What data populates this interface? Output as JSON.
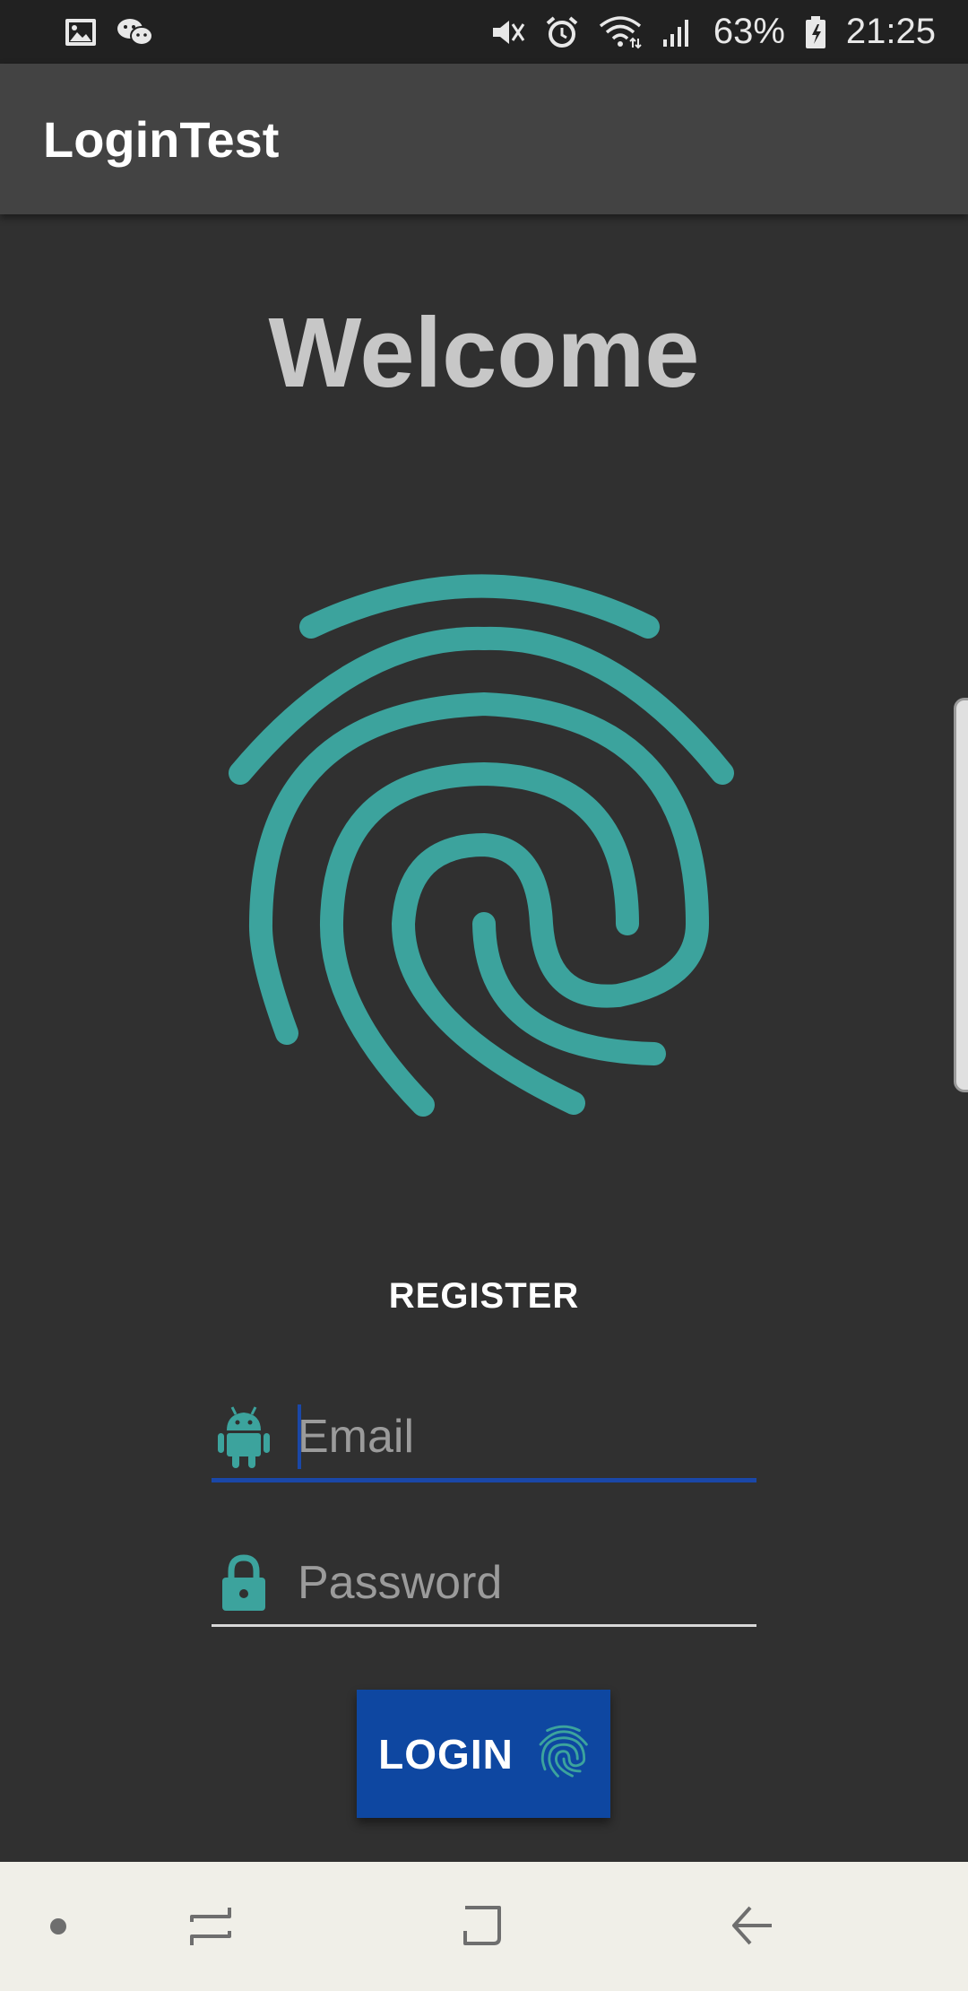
{
  "status_bar": {
    "battery": "63%",
    "time": "21:25",
    "left_icons": [
      "image-icon",
      "wechat-icon"
    ],
    "right_icons": [
      "vibrate-mute-icon",
      "alarm-icon",
      "wifi-icon",
      "signal-icon",
      "battery-charging-icon"
    ]
  },
  "app_bar": {
    "title": "LoginTest"
  },
  "main": {
    "welcome": "Welcome",
    "register_label": "REGISTER",
    "email": {
      "placeholder": "Email",
      "value": "",
      "icon": "android-icon"
    },
    "password": {
      "placeholder": "Password",
      "value": "",
      "icon": "lock-icon"
    },
    "login_label": "LOGIN",
    "login_icon": "fingerprint-icon"
  },
  "colors": {
    "background": "#303030",
    "status_bar": "#212121",
    "app_bar": "#434343",
    "accent_teal": "#3ca39d",
    "primary_blue": "#0e47a1",
    "welcome_text": "#c7c7c7",
    "nav_bar": "#f0efe8"
  },
  "nav_bar": {
    "icons": [
      "dot-icon",
      "recent-apps-icon",
      "home-icon",
      "back-icon"
    ]
  }
}
